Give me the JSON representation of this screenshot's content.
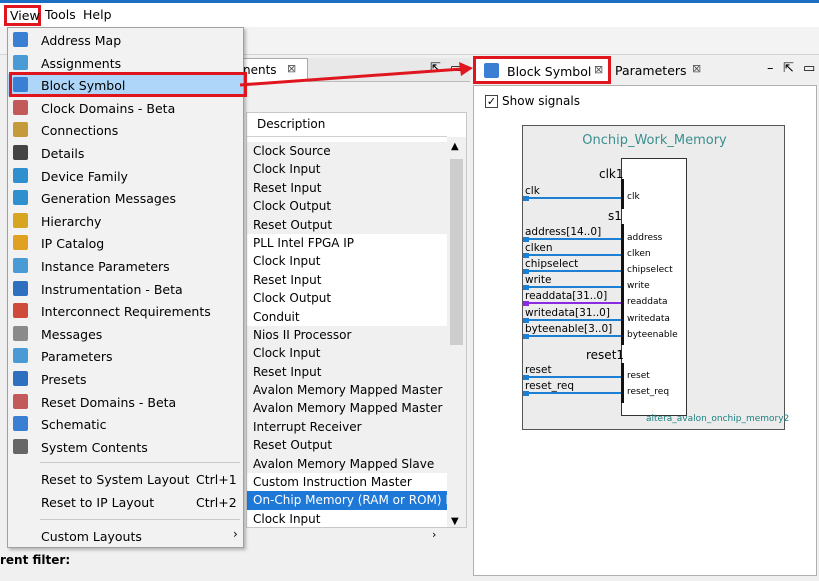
{
  "menubar": {
    "view": "View",
    "tools": "Tools",
    "help": "Help"
  },
  "menu": {
    "items": [
      {
        "label": "Address Map",
        "icon": "address-map-icon",
        "color": "#3b7fd4"
      },
      {
        "label": "Assignments",
        "icon": "assignments-icon",
        "color": "#4a9ad6"
      },
      {
        "label": "Block Symbol",
        "icon": "block-symbol-icon",
        "color": "#3b7fd4",
        "highlighted": true
      },
      {
        "label": "Clock Domains - Beta",
        "icon": "clock-domains-icon",
        "color": "#c25a5a"
      },
      {
        "label": "Connections",
        "icon": "connections-icon",
        "color": "#c49a3a"
      },
      {
        "label": "Details",
        "icon": "details-icon",
        "color": "#444444"
      },
      {
        "label": "Device Family",
        "icon": "device-family-icon",
        "color": "#2f8fcf"
      },
      {
        "label": "Generation Messages",
        "icon": "generation-messages-icon",
        "color": "#2f8fcf"
      },
      {
        "label": "Hierarchy",
        "icon": "hierarchy-icon",
        "color": "#d8a520"
      },
      {
        "label": "IP Catalog",
        "icon": "ip-catalog-icon",
        "color": "#e0a020"
      },
      {
        "label": "Instance Parameters",
        "icon": "instance-parameters-icon",
        "color": "#4a9ad6"
      },
      {
        "label": "Instrumentation - Beta",
        "icon": "instrumentation-icon",
        "color": "#2f6fbf"
      },
      {
        "label": "Interconnect Requirements",
        "icon": "interconnect-icon",
        "color": "#d04a3a"
      },
      {
        "label": "Messages",
        "icon": "messages-icon",
        "color": "#8a8a8a"
      },
      {
        "label": "Parameters",
        "icon": "parameters-icon",
        "color": "#4a9ad6"
      },
      {
        "label": "Presets",
        "icon": "presets-icon",
        "color": "#2f6fbf"
      },
      {
        "label": "Reset Domains - Beta",
        "icon": "reset-domains-icon",
        "color": "#c25a5a"
      },
      {
        "label": "Schematic",
        "icon": "schematic-icon",
        "color": "#3b7fd4"
      },
      {
        "label": "System Contents",
        "icon": "system-contents-icon",
        "color": "#666666"
      }
    ],
    "layout_items": [
      {
        "label": "Reset to System Layout",
        "shortcut": "Ctrl+1"
      },
      {
        "label": "Reset to IP Layout",
        "shortcut": "Ctrl+2"
      }
    ],
    "custom_layouts": "Custom Layouts",
    "submenu_arrow": "›"
  },
  "left_panel": {
    "tab_label": "nents",
    "tab_close": "⊠",
    "column_header": "Description",
    "rows": [
      "Clock Source",
      "Clock Input",
      "Reset Input",
      "Clock Output",
      "Reset Output",
      "PLL Intel FPGA IP",
      "Clock Input",
      "Reset Input",
      "Clock Output",
      "Conduit",
      "Nios II Processor",
      "Clock Input",
      "Reset Input",
      "Avalon Memory Mapped Master",
      "Avalon Memory Mapped Master",
      "Interrupt Receiver",
      "Reset Output",
      "Avalon Memory Mapped Slave",
      "Custom Instruction Master",
      "On-Chip Memory (RAM or ROM) Inte",
      "Clock Input"
    ],
    "shaded_rows": [
      0,
      1,
      2,
      3,
      4,
      10,
      11,
      12,
      13,
      14,
      15,
      16,
      17
    ],
    "selected_row": 19,
    "filter_label": "rent filter:",
    "row_prefix_19": ".",
    "row_prefix_20": ""
  },
  "right_panel": {
    "active_tab": "Block Symbol",
    "tab_close": "⊠",
    "second_tab": "Parameters",
    "show_signals_label": "Show signals",
    "show_signals_checked": true,
    "checkmark": "✓",
    "component": {
      "title": "Onchip_Work_Memory",
      "type_name": "altera_avalon_onchip_memory2",
      "interfaces": [
        "clk1",
        "s1",
        "reset1"
      ],
      "external_signals": [
        "clk",
        "address[14..0]",
        "clken",
        "chipselect",
        "write",
        "readdata[31..0]",
        "writedata[31..0]",
        "byteenable[3..0]",
        "reset",
        "reset_req"
      ],
      "internal_signals": [
        "clk",
        "address",
        "clken",
        "chipselect",
        "write",
        "readdata",
        "writedata",
        "byteenable",
        "reset",
        "reset_req"
      ],
      "wire_color": "#1c7fd1",
      "readdata_color": "#8a2be2"
    }
  },
  "colors": {
    "highlight_red": "#e0161f",
    "selection_blue": "#1e78d7",
    "menu_hover": "#aed6f9"
  }
}
